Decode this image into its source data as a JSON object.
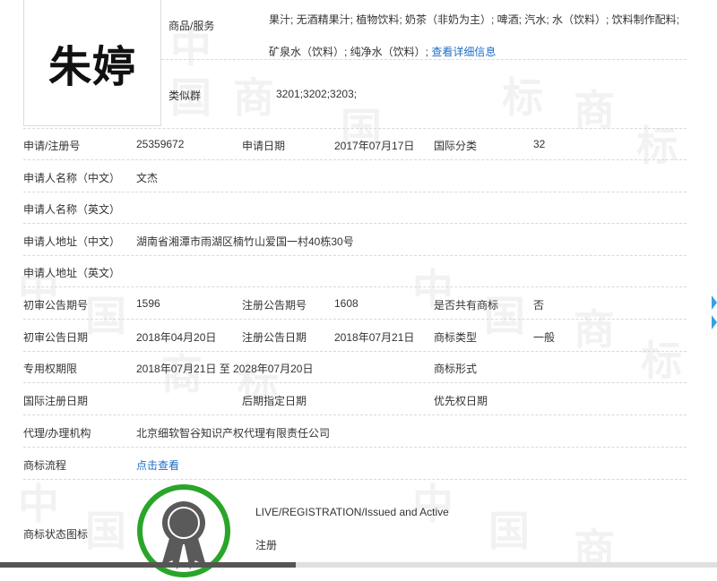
{
  "trademark_name": "朱婷",
  "goods_services": {
    "label": "商品/服务",
    "text": "果汁; 无酒精果汁; 植物饮料; 奶茶（非奶为主）; 啤酒; 汽水; 水（饮料）; 饮料制作配料; 矿泉水（饮料）; 纯净水（饮料）;",
    "more_link": "查看详细信息"
  },
  "similar_group": {
    "label": "类似群",
    "value": "3201;3202;3203;"
  },
  "rows": {
    "reg_no": {
      "label": "申请/注册号",
      "value": "25359672"
    },
    "app_date": {
      "label": "申请日期",
      "value": "2017年07月17日"
    },
    "intl_class": {
      "label": "国际分类",
      "value": "32"
    },
    "applicant_cn": {
      "label": "申请人名称（中文）",
      "value": "文杰"
    },
    "applicant_en": {
      "label": "申请人名称（英文）",
      "value": ""
    },
    "address_cn": {
      "label": "申请人地址（中文）",
      "value": "湖南省湘潭市雨湖区楠竹山爱国一村40栋30号"
    },
    "address_en": {
      "label": "申请人地址（英文）",
      "value": ""
    },
    "prelim_no": {
      "label": "初审公告期号",
      "value": "1596"
    },
    "reg_pub_no": {
      "label": "注册公告期号",
      "value": "1608"
    },
    "shared": {
      "label": "是否共有商标",
      "value": "否"
    },
    "prelim_date": {
      "label": "初审公告日期",
      "value": "2018年04月20日"
    },
    "reg_pub_date": {
      "label": "注册公告日期",
      "value": "2018年07月21日"
    },
    "tm_type": {
      "label": "商标类型",
      "value": "一般"
    },
    "exclusive": {
      "label": "专用权期限",
      "value": "2018年07月21日 至 2028年07月20日"
    },
    "tm_form": {
      "label": "商标形式",
      "value": ""
    },
    "intl_reg_date": {
      "label": "国际注册日期",
      "value": ""
    },
    "later_date": {
      "label": "后期指定日期",
      "value": ""
    },
    "priority_date": {
      "label": "优先权日期",
      "value": ""
    },
    "agent": {
      "label": "代理/办理机构",
      "value": "北京细软智谷知识产权代理有限责任公司"
    },
    "flow": {
      "label": "商标流程",
      "link": "点击查看"
    },
    "status_icon": {
      "label": "商标状态图标",
      "status_en": "LIVE/REGISTRATION/Issued and Active",
      "status_cn": "注册"
    }
  },
  "watermark": [
    "中",
    "国",
    "商",
    "标"
  ],
  "colors": {
    "link": "#1e6ec8",
    "badge_green": "#2aa52a",
    "badge_dark": "#5a5a5a"
  }
}
